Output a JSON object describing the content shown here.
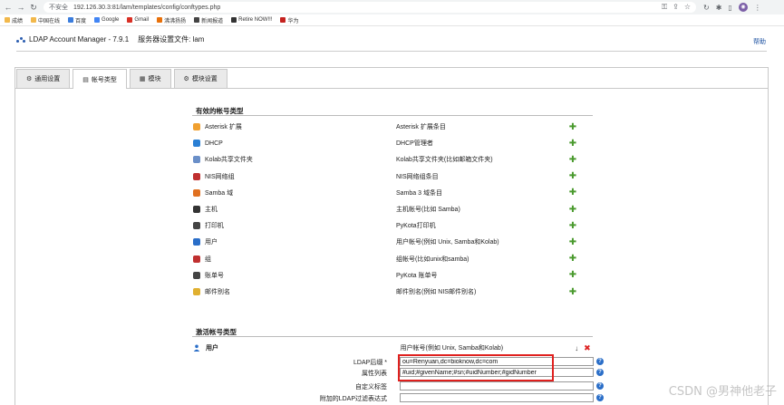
{
  "browser": {
    "insecure_label": "不安全",
    "url": "192.126.30.3:81/lam/templates/config/conftypes.php",
    "bookmarks": [
      "成绩",
      "中国在线",
      "百度",
      "Google",
      "Gmail",
      "沸沸扬扬",
      "新闻报道",
      "Retire NOW!!!",
      "华为"
    ]
  },
  "app": {
    "title": "LDAP Account Manager - 7.9.1",
    "server_profile_label": "服务器设置文件: lam",
    "help": "帮助"
  },
  "tabs": [
    {
      "label": "通用设置",
      "icon": "gear-icon",
      "active": false
    },
    {
      "label": "帐号类型",
      "icon": "account-types-icon",
      "active": true
    },
    {
      "label": "模块",
      "icon": "modules-icon",
      "active": false
    },
    {
      "label": "模块设置",
      "icon": "module-settings-icon",
      "active": false
    }
  ],
  "available": {
    "title": "有效的帐号类型",
    "items": [
      {
        "name": "Asterisk 扩展",
        "desc": "Asterisk 扩展条目",
        "icon": "asterisk-icon",
        "color": "#f0a030"
      },
      {
        "name": "DHCP",
        "desc": "DHCP管理者",
        "icon": "dhcp-icon",
        "color": "#2a7fd4"
      },
      {
        "name": "Kolab共享文件夹",
        "desc": "Kolab共享文件夹(比如邮箱文件夹)",
        "icon": "kolab-icon",
        "color": "#6a8fc8"
      },
      {
        "name": "NIS网络组",
        "desc": "NIS网络组条目",
        "icon": "nis-netgroup-icon",
        "color": "#c03030"
      },
      {
        "name": "Samba 域",
        "desc": "Samba 3 域条目",
        "icon": "samba-domain-icon",
        "color": "#e07020"
      },
      {
        "name": "主机",
        "desc": "主机帐号(比如 Samba)",
        "icon": "host-icon",
        "color": "#333333"
      },
      {
        "name": "打印机",
        "desc": "PyKota打印机",
        "icon": "printer-icon",
        "color": "#444444"
      },
      {
        "name": "用户",
        "desc": "用户帐号(例如 Unix, Samba和Kolab)",
        "icon": "user-icon",
        "color": "#2a6ec8"
      },
      {
        "name": "组",
        "desc": "组帐号(比如unix和samba)",
        "icon": "group-icon",
        "color": "#c03030"
      },
      {
        "name": "账单号",
        "desc": "PyKota 账单号",
        "icon": "billing-icon",
        "color": "#444444"
      },
      {
        "name": "邮件别名",
        "desc": "邮件别名(例如 NIS邮件别名)",
        "icon": "mail-alias-icon",
        "color": "#e0b030"
      }
    ]
  },
  "active": {
    "title": "激活帐号类型",
    "item": {
      "name": "用户",
      "desc": "用户帐号(例如 Unix, Samba和Kolab)",
      "icon": "user-icon"
    },
    "fields": [
      {
        "label": "LDAP后缀 *",
        "value": "ou=Renyuan,dc=bioknow,dc=com"
      },
      {
        "label": "属性列表",
        "value": "#uid;#givenName;#sn;#uidNumber;#gidNumber"
      },
      {
        "label": "自定义标签",
        "value": ""
      },
      {
        "label": "附加的LDAP过滤表达式",
        "value": ""
      }
    ]
  },
  "watermark": "CSDN @男神他老子"
}
